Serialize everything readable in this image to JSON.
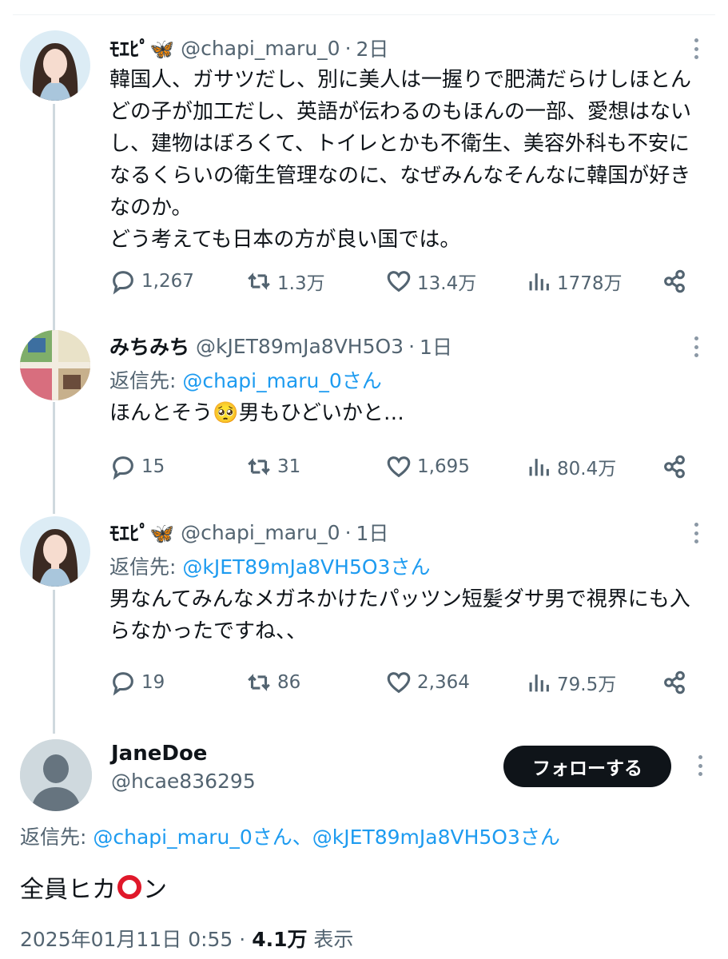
{
  "tweets": [
    {
      "name": "ﾓｴﾋﾟ🦋",
      "handle": "@chapi_maru_0",
      "time": "2日",
      "reply_prefix": "",
      "reply_to": "",
      "text": "韓国人、ガサツだし、別に美人は一握りで肥満だらけしほとんどの子が加工だし、英語が伝わるのもほんの一部、愛想はないし、建物はぼろくて、トイレとかも不衛生、美容外科も不安になるくらいの衛生管理なのに、なぜみんなそんなに韓国が好きなのか。\nどう考えても日本の方が良い国では。",
      "replies": "1,267",
      "retweets": "1.3万",
      "likes": "13.4万",
      "views": "1778万"
    },
    {
      "name": "みちみち",
      "handle": "@kJET89mJa8VH5O3",
      "time": "1日",
      "reply_prefix": "返信先: ",
      "reply_to": "@chapi_maru_0さん",
      "text": "ほんとそう🥺男もひどいかと…",
      "replies": "15",
      "retweets": "31",
      "likes": "1,695",
      "views": "80.4万"
    },
    {
      "name": "ﾓｴﾋﾟ🦋",
      "handle": "@chapi_maru_0",
      "time": "1日",
      "reply_prefix": "返信先: ",
      "reply_to": "@kJET89mJa8VH5O3さん",
      "text": "男なんてみんなメガネかけたパッツン短髪ダサ男で視界にも入らなかったですね、、",
      "replies": "19",
      "retweets": "86",
      "likes": "2,364",
      "views": "79.5万"
    }
  ],
  "main": {
    "name": "JaneDoe",
    "handle": "@hcae836295",
    "follow_label": "フォローする",
    "reply_prefix": "返信先: ",
    "reply_to": "@chapi_maru_0さん、@kJET89mJa8VH5O3さん",
    "text_before": "全員ヒカ",
    "text_after": "ン",
    "date": "2025年01月11日 0:55 · ",
    "views": "4.1万",
    "views_suffix": " 表示"
  },
  "colors": {
    "link": "#1d9bf0",
    "muted": "#536471",
    "text": "#0f1419",
    "ring": "#e0182a"
  },
  "icons": [
    "reply-icon",
    "retweet-icon",
    "like-icon",
    "views-icon",
    "share-icon",
    "more-icon"
  ]
}
